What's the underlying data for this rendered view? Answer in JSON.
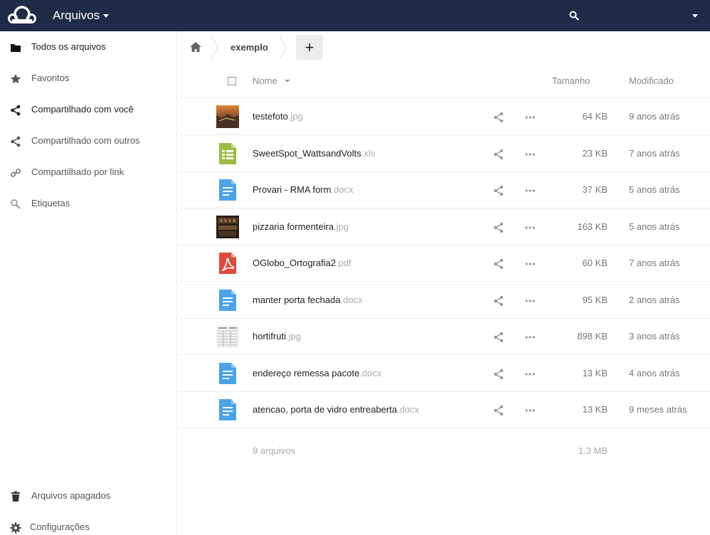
{
  "header": {
    "app_title": "Arquivos"
  },
  "sidebar": {
    "items": [
      {
        "label": "Todos os arquivos",
        "icon": "folder-icon"
      },
      {
        "label": "Favoritos",
        "icon": "star-icon"
      },
      {
        "label": "Compartilhado com você",
        "icon": "share-icon"
      },
      {
        "label": "Compartilhado com outros",
        "icon": "share-icon"
      },
      {
        "label": "Compartilhado por link",
        "icon": "link-icon"
      },
      {
        "label": "Etiquetas",
        "icon": "tag-search-icon"
      }
    ],
    "bottom": [
      {
        "label": "Arquivos apagados",
        "icon": "trash-icon"
      },
      {
        "label": "Configurações",
        "icon": "gear-icon"
      }
    ]
  },
  "breadcrumb": {
    "current": "exemplo",
    "new_button": "+"
  },
  "table": {
    "headers": {
      "name": "Nome",
      "size": "Tamanho",
      "modified": "Modificado"
    },
    "rows": [
      {
        "name": "testefoto",
        "ext": ".jpg",
        "size": "64 KB",
        "modified": "9 anos atrás",
        "type": "image-warm"
      },
      {
        "name": "SweetSpot_WattsandVolts",
        "ext": ".xls",
        "size": "23 KB",
        "modified": "7 anos atrás",
        "type": "spreadsheet"
      },
      {
        "name": "Provari - RMA form",
        "ext": ".docx",
        "size": "37 KB",
        "modified": "5 anos atrás",
        "type": "document"
      },
      {
        "name": "pizzaria formenteira",
        "ext": ".jpg",
        "size": "163 KB",
        "modified": "5 anos atrás",
        "type": "image-dark"
      },
      {
        "name": "OGlobo_Ortografia2",
        "ext": ".pdf",
        "size": "60 KB",
        "modified": "7 anos atrás",
        "type": "pdf"
      },
      {
        "name": "manter porta fechada",
        "ext": ".docx",
        "size": "95 KB",
        "modified": "2 anos atrás",
        "type": "document"
      },
      {
        "name": "hortifruti",
        "ext": ".jpg",
        "size": "898 KB",
        "modified": "3 anos atrás",
        "type": "image-doc"
      },
      {
        "name": "endereço remessa pacote",
        "ext": ".docx",
        "size": "13 KB",
        "modified": "4 anos atrás",
        "type": "document"
      },
      {
        "name": "atencao, porta de vidro entreaberta",
        "ext": ".docx",
        "size": "13 KB",
        "modified": "9 meses atrás",
        "type": "document"
      }
    ],
    "summary": {
      "count": "9 arquivos",
      "total_size": "1.3 MB"
    }
  },
  "colors": {
    "header_bg": "#1f2c47",
    "doc_blue": "#4ba3e8",
    "sheet_green": "#9bbd45",
    "pdf_red": "#e14a3c"
  }
}
